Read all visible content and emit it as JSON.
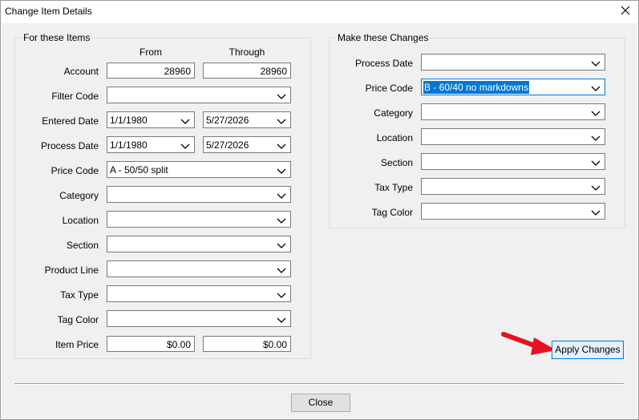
{
  "window": {
    "title": "Change Item Details",
    "close_icon": "close-icon"
  },
  "left_group": {
    "legend": "For these Items",
    "from_header": "From",
    "through_header": "Through",
    "account": {
      "label": "Account",
      "from": "28960",
      "through": "28960"
    },
    "filter_code": {
      "label": "Filter Code",
      "value": ""
    },
    "entered_date": {
      "label": "Entered Date",
      "from": "1/1/1980",
      "through": "5/27/2026"
    },
    "process_date": {
      "label": "Process Date",
      "from": "1/1/1980",
      "through": "5/27/2026"
    },
    "price_code": {
      "label": "Price Code",
      "value": "A - 50/50 split"
    },
    "category": {
      "label": "Category",
      "value": ""
    },
    "location": {
      "label": "Location",
      "value": ""
    },
    "section": {
      "label": "Section",
      "value": ""
    },
    "product_line": {
      "label": "Product Line",
      "value": ""
    },
    "tax_type": {
      "label": "Tax Type",
      "value": ""
    },
    "tag_color": {
      "label": "Tag Color",
      "value": ""
    },
    "item_price": {
      "label": "Item Price",
      "from": "$0.00",
      "through": "$0.00"
    }
  },
  "right_group": {
    "legend": "Make these Changes",
    "process_date": {
      "label": "Process Date",
      "value": ""
    },
    "price_code": {
      "label": "Price Code",
      "value": "B - 60/40 no markdowns"
    },
    "category": {
      "label": "Category",
      "value": ""
    },
    "location": {
      "label": "Location",
      "value": ""
    },
    "section": {
      "label": "Section",
      "value": ""
    },
    "tax_type": {
      "label": "Tax Type",
      "value": ""
    },
    "tag_color": {
      "label": "Tag Color",
      "value": ""
    }
  },
  "buttons": {
    "apply": "Apply Changes",
    "close": "Close"
  },
  "colors": {
    "accent": "#0078d7",
    "arrow": "#e81123",
    "dialog_bg": "#f0f0f0"
  }
}
